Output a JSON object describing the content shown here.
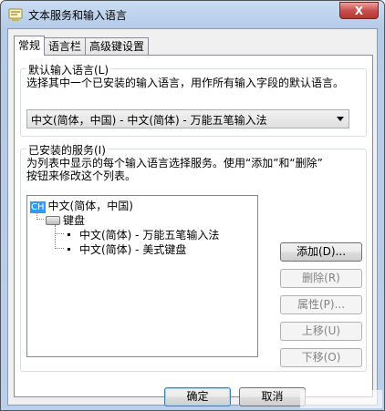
{
  "window": {
    "title": "文本服务和输入语言",
    "close_label": "X"
  },
  "tabs": [
    {
      "label": "常规",
      "active": true
    },
    {
      "label": "语言栏",
      "active": false
    },
    {
      "label": "高级键设置",
      "active": false
    }
  ],
  "default_language": {
    "group_title": "默认输入语言(L)",
    "description": "选择其中一个已安装的输入语言，用作所有输入字段的默认语言。",
    "selected": "中文(简体，中国) - 中文(简体) - 万能五笔输入法"
  },
  "installed_services": {
    "group_title": "已安装的服务(I)",
    "description_line1": "为列表中显示的每个输入语言选择服务。使用“添加”和“删除”",
    "description_line2": "按钮来修改这个列表。",
    "tree": {
      "language_badge": "CH",
      "language": "中文(简体，中国)",
      "category": "键盘",
      "items": [
        "中文(简体) - 万能五笔输入法",
        "中文(简体) - 美式键盘"
      ]
    },
    "buttons": {
      "add": "添加(D)...",
      "remove": "删除(R)",
      "properties": "属性(P)...",
      "move_up": "上移(U)",
      "move_down": "下移(O)"
    }
  },
  "footer": {
    "ok": "确定",
    "cancel": "取消"
  },
  "colors": {
    "accent": "#3399ff",
    "close": "#c75050"
  }
}
